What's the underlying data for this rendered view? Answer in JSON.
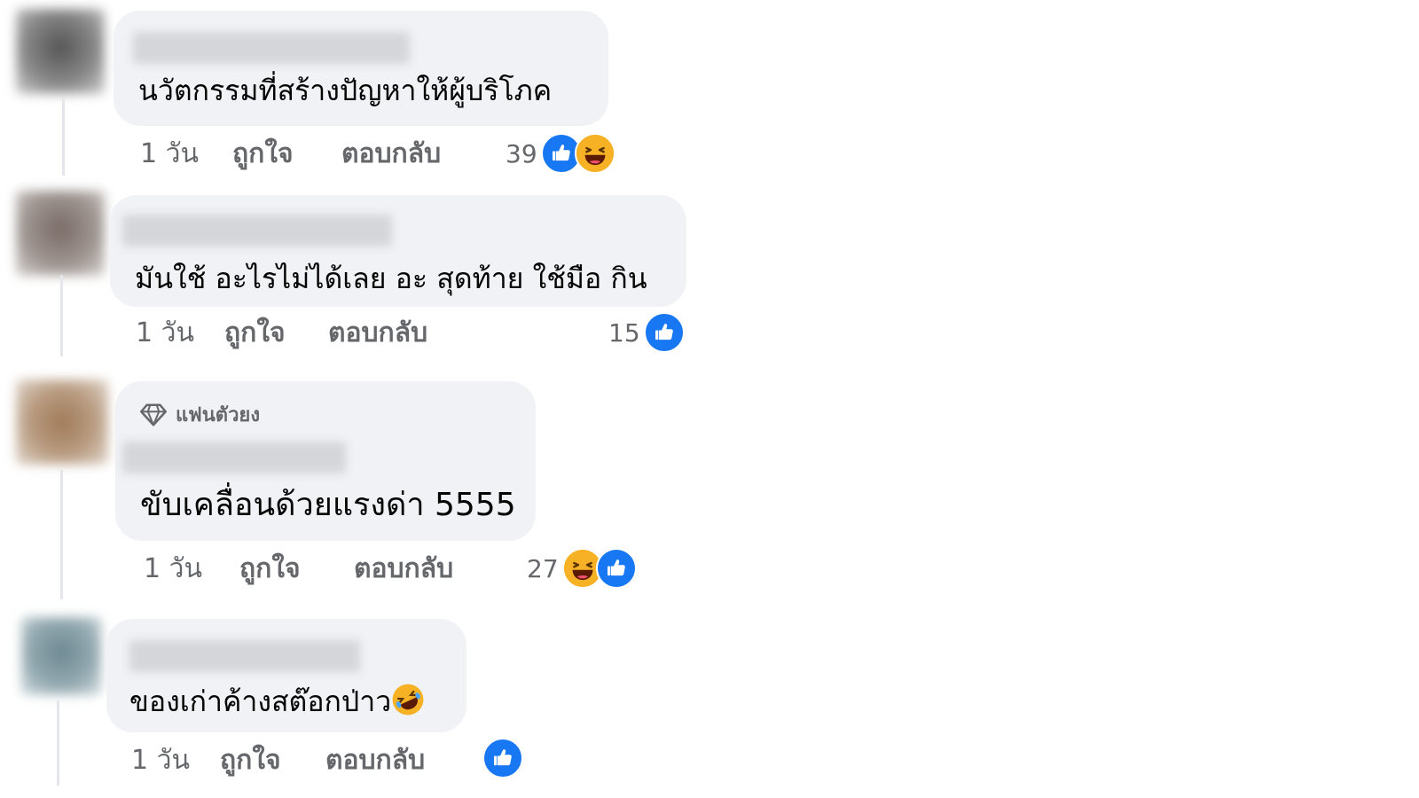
{
  "comments": [
    {
      "text": "นวัตกรรมที่สร้างปัญหาให้ผู้บริโภค",
      "time": "1 วัน",
      "like_label": "ถูกใจ",
      "reply_label": "ตอบกลับ",
      "reaction_count": "39",
      "reactions": [
        "like-icon",
        "haha-icon"
      ]
    },
    {
      "text": "มันใช้ อะไรไม่ได้เลย อะ สุดท้าย ใช้มือ กิน",
      "time": "1 วัน",
      "like_label": "ถูกใจ",
      "reply_label": "ตอบกลับ",
      "reaction_count": "15",
      "reactions": [
        "like-icon"
      ]
    },
    {
      "badge": "แฟนตัวยง",
      "badge_icon": "diamond-icon",
      "text": "ขับเคลื่อนด้วยแรงด่า 5555",
      "time": "1 วัน",
      "like_label": "ถูกใจ",
      "reply_label": "ตอบกลับ",
      "reaction_count": "27",
      "reactions": [
        "haha-icon",
        "like-icon"
      ]
    },
    {
      "text": "ของเก่าค้างสต๊อกป่าว",
      "trailing_emoji": "rolling-laughing-emoji-icon",
      "time": "1 วัน",
      "like_label": "ถูกใจ",
      "reply_label": "ตอบกลับ",
      "reaction_count": "",
      "reactions": [
        "like-icon"
      ]
    }
  ],
  "colors": {
    "bubble": "#f0f2f5",
    "like": "#1877f2",
    "haha": "#f7b125",
    "meta_text": "#65676b"
  }
}
